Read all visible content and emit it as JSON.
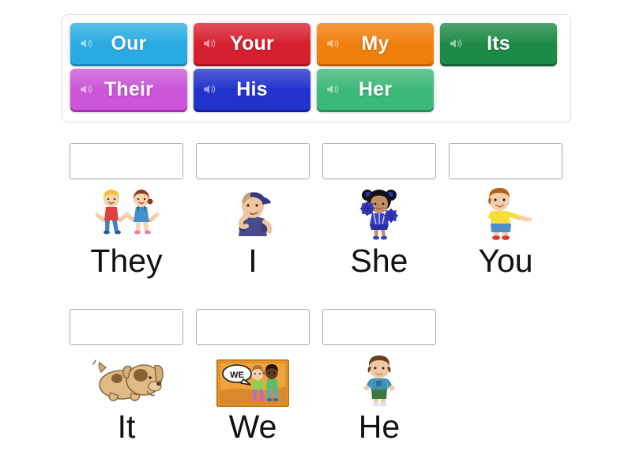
{
  "activity": {
    "type": "match-up-drag-and-drop"
  },
  "word_bank": {
    "name": "possessive-adjectives-word-bank",
    "audio_icon": "speaker-icon",
    "rows": [
      [
        {
          "label": "Our",
          "color": "#29ABE2",
          "shadow": "#1d86b4"
        },
        {
          "label": "Your",
          "color": "#D62030",
          "shadow": "#a3161f"
        },
        {
          "label": "My",
          "color": "#F07F0C",
          "shadow": "#c05f05"
        },
        {
          "label": "Its",
          "color": "#1E8A47",
          "shadow": "#146132"
        }
      ],
      [
        {
          "label": "Their",
          "color": "#CB56D8",
          "shadow": "#a62fb5"
        },
        {
          "label": "His",
          "color": "#2233CC",
          "shadow": "#16229b"
        },
        {
          "label": "Her",
          "color": "#3CB878",
          "shadow": "#2a8c59"
        }
      ]
    ]
  },
  "answer_rows": [
    {
      "name": "answer-row-1",
      "cards": [
        {
          "word": "They",
          "art": "two-children-jumping-image",
          "drop_zone": "drop-zone-they"
        },
        {
          "word": "I",
          "art": "boy-with-cap-pointing-self-image",
          "drop_zone": "drop-zone-i"
        },
        {
          "word": "She",
          "art": "cheerleader-girl-image",
          "drop_zone": "drop-zone-she"
        },
        {
          "word": "You",
          "art": "boy-pointing-forward-image",
          "drop_zone": "drop-zone-you"
        }
      ]
    },
    {
      "name": "answer-row-2",
      "cards": [
        {
          "word": "It",
          "art": "puppy-dog-image",
          "drop_zone": "drop-zone-it"
        },
        {
          "word": "We",
          "art": "we-speech-bubble-card-image",
          "drop_zone": "drop-zone-we"
        },
        {
          "word": "He",
          "art": "boy-standing-image",
          "drop_zone": "drop-zone-he"
        }
      ]
    }
  ],
  "we_card": {
    "bubble_text": "WE"
  },
  "colors": {
    "page_background": "#FFFFFF",
    "bank_border": "#DCDCDC",
    "drop_zone_border": "#A8A8A8",
    "word_text": "#111111",
    "tile_text": "#FFFFFF"
  }
}
